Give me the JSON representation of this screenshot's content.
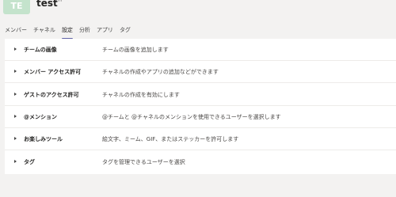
{
  "team": {
    "avatar_initials": "TE",
    "name": "test",
    "more": "···"
  },
  "tabs": [
    {
      "label": "メンバー"
    },
    {
      "label": "チャネル"
    },
    {
      "label": "設定"
    },
    {
      "label": "分析"
    },
    {
      "label": "アプリ"
    },
    {
      "label": "タグ"
    }
  ],
  "active_tab": "設定",
  "settings": [
    {
      "title": "チームの画像",
      "description": "チームの画像を追加します"
    },
    {
      "title": "メンバー アクセス許可",
      "description": "チャネルの作成やアプリの追加などができます"
    },
    {
      "title": "ゲストのアクセス許可",
      "description": "チャネルの作成を有効にします"
    },
    {
      "title": "@メンション",
      "description": "@チームと @チャネルのメンションを使用できるユーザーを選択します"
    },
    {
      "title": "お楽しみツール",
      "description": "絵文字、ミーム、GIF、またはステッカーを許可します"
    },
    {
      "title": "タグ",
      "description": "タグを管理できるユーザーを選択"
    }
  ],
  "colors": {
    "accent": "#6264a7",
    "background": "#f3f2f1",
    "panel": "#ffffff",
    "avatar": "#c4e3cc"
  }
}
